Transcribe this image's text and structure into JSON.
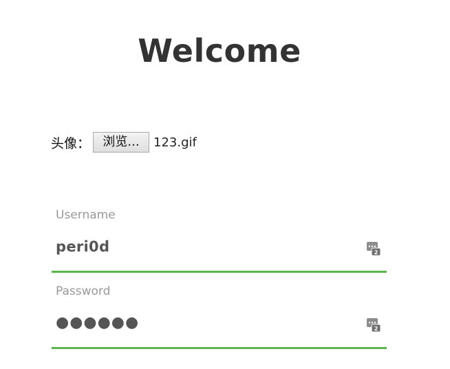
{
  "header": {
    "title": "Welcome"
  },
  "avatar": {
    "label": "头像：",
    "browse_label": "浏览...",
    "file_name": "123.gif"
  },
  "form": {
    "username": {
      "label": "Username",
      "value": "peri0d",
      "icon": "password-manager-icon"
    },
    "password": {
      "label": "Password",
      "value": "●●●●●●",
      "icon": "password-manager-icon"
    }
  },
  "colors": {
    "title": "#333333",
    "accent_underline": "#5cb54a",
    "label": "#999999",
    "value": "#555555"
  }
}
